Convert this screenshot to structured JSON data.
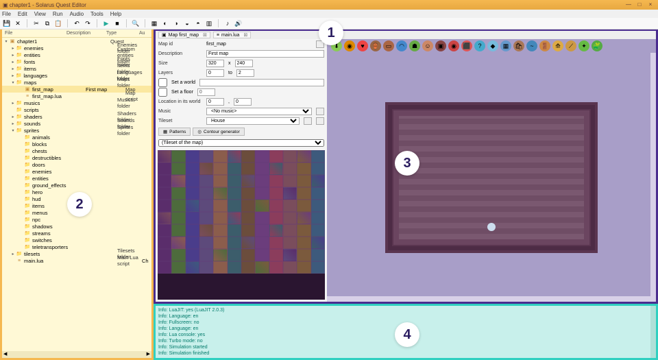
{
  "window": {
    "title": "chapter1 - Solarus Quest Editor",
    "min": "—",
    "max": "□",
    "close": "×"
  },
  "menu": {
    "file": "File",
    "edit": "Edit",
    "view": "View",
    "run": "Run",
    "audio": "Audio",
    "tools": "Tools",
    "help": "Help"
  },
  "callouts": {
    "c1": "1",
    "c2": "2",
    "c3": "3",
    "c4": "4"
  },
  "tree": {
    "headers": {
      "file": "File",
      "desc": "Description",
      "type": "Type",
      "au": "Au"
    },
    "root": "chapter1",
    "root_type": "Quest",
    "items": [
      {
        "name": "enemies",
        "type": "Enemies folder"
      },
      {
        "name": "entities",
        "type": "Custom entities folder"
      },
      {
        "name": "fonts",
        "type": "Fonts folder"
      },
      {
        "name": "items",
        "type": "Items folder"
      },
      {
        "name": "languages",
        "type": "Languages folder"
      },
      {
        "name": "maps",
        "type": "Maps folder",
        "open": true,
        "children": [
          {
            "name": "first_map",
            "desc": "First map",
            "type": "Map"
          },
          {
            "name": "first_map.lua",
            "type": "Map script"
          }
        ]
      },
      {
        "name": "musics",
        "type": "Musics folder"
      },
      {
        "name": "scripts",
        "type": ""
      },
      {
        "name": "shaders",
        "type": "Shaders folder"
      },
      {
        "name": "sounds",
        "type": "Sounds folder"
      },
      {
        "name": "sprites",
        "type": "Sprites folder",
        "open": true,
        "children": [
          {
            "name": "animals"
          },
          {
            "name": "blocks"
          },
          {
            "name": "chests"
          },
          {
            "name": "destructibles"
          },
          {
            "name": "doors"
          },
          {
            "name": "enemies"
          },
          {
            "name": "entities"
          },
          {
            "name": "ground_effects"
          },
          {
            "name": "hero"
          },
          {
            "name": "hud"
          },
          {
            "name": "items"
          },
          {
            "name": "menus"
          },
          {
            "name": "npc"
          },
          {
            "name": "shadows"
          },
          {
            "name": "streams"
          },
          {
            "name": "switches"
          },
          {
            "name": "teletransporters"
          }
        ]
      },
      {
        "name": "tilesets",
        "type": "Tilesets folder"
      },
      {
        "name": "main.lua",
        "type": "Main Lua script",
        "au": "Ch"
      }
    ]
  },
  "tabs": {
    "t1": "Map first_map",
    "t2": "main.lua"
  },
  "props": {
    "map_id_label": "Map id",
    "map_id": "first_map",
    "desc_label": "Description",
    "desc": "First map",
    "size_label": "Size",
    "size_w": "320",
    "size_x": "x",
    "size_h": "240",
    "layers_label": "Layers",
    "layers_from": "0",
    "layers_to_label": "to",
    "layers_to": "2",
    "world_label": "Set a world",
    "floor_label": "Set a floor",
    "floor_val": "0",
    "loc_label": "Location in its world",
    "loc_x": "0",
    "loc_sep": ",",
    "loc_y": "0",
    "music_label": "Music",
    "music_val": "<No music>",
    "tileset_label": "Tileset",
    "tileset_val": "House",
    "tab_patterns": "Patterns",
    "tab_contour": "Contour generator",
    "tileset_sel": "(Tileset of the map)"
  },
  "console": {
    "lines": [
      "Info: LuaJIT: yes (LuaJIT 2.0.3)",
      "Info: Language: en",
      "Info: Fullscreen: no",
      "Info: Language: en",
      "Info: Lua console: yes",
      "Info: Turbo mode: no",
      "Info: Simulation started",
      "Info: Simulation finished"
    ]
  }
}
